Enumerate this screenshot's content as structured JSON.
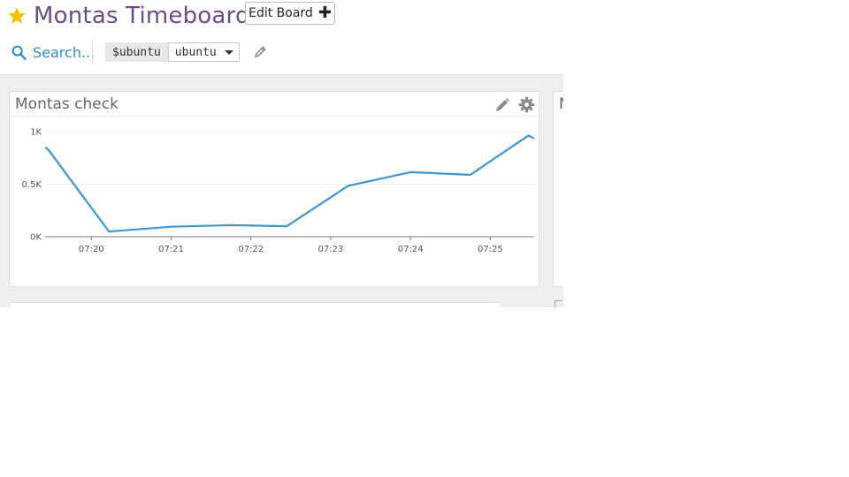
{
  "header": {
    "title": "Montas Timeboard",
    "edit_button_label": "Edit Board",
    "edit_button_icon": "plus-icon",
    "favorite_icon": "star-icon",
    "favorite_color": "#f2c200",
    "title_color": "#6b4b8a",
    "search_label": "Search...",
    "search_icon": "search-icon",
    "accent_color": "#2d8fc4",
    "template_variable": {
      "name": "$ubuntu",
      "selected_value": "ubuntu"
    }
  },
  "widgets": [
    {
      "title": "Montas check",
      "icons": [
        "pencil-icon",
        "gear-icon"
      ]
    },
    {
      "title": "M"
    }
  ],
  "chart_data": {
    "type": "line",
    "title": "Montas check",
    "xlabel": "",
    "ylabel": "",
    "x_ticks": [
      "07:20",
      "07:21",
      "07:22",
      "07:23",
      "07:24",
      "07:25"
    ],
    "y_ticks": [
      "0K",
      "0.5K",
      "1K"
    ],
    "ylim": [
      0,
      1000
    ],
    "xlim_minutes": [
      19.42,
      25.55
    ],
    "grid": true,
    "legend": "none",
    "series": [
      {
        "color": "#3c96cf",
        "points": [
          {
            "x": 19.42,
            "y": 850
          },
          {
            "x": 19.45,
            "y": 840
          },
          {
            "x": 20.22,
            "y": 50
          },
          {
            "x": 21.0,
            "y": 95
          },
          {
            "x": 21.75,
            "y": 110
          },
          {
            "x": 22.45,
            "y": 100
          },
          {
            "x": 23.22,
            "y": 485
          },
          {
            "x": 24.0,
            "y": 615
          },
          {
            "x": 24.75,
            "y": 590
          },
          {
            "x": 25.48,
            "y": 965
          },
          {
            "x": 25.55,
            "y": 935
          }
        ]
      }
    ]
  }
}
